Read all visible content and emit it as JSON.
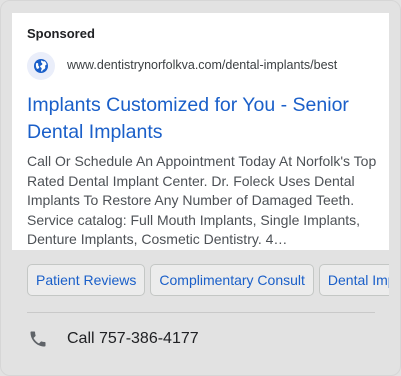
{
  "ad": {
    "label": "Sponsored",
    "favicon_icon": "globe-icon",
    "display_url": "www.dentistrynorfolkva.com/dental-implants/best",
    "headline": "Implants Customized for You - Senior Dental Implants",
    "description": "Call Or Schedule An Appointment Today At Norfolk's Top Rated Dental Implant Center. Dr. Foleck Uses Dental Implants To Restore Any Number of Damaged Teeth. Service catalog: Full Mouth Implants, Single Implants, Denture Implants, Cosmetic Dentistry. 4…"
  },
  "sitelinks": [
    {
      "label": "Patient Reviews"
    },
    {
      "label": "Complimentary Consult"
    },
    {
      "label": "Dental Implants"
    }
  ],
  "call": {
    "icon": "phone-icon",
    "label": "Call 757-386-4177"
  },
  "colors": {
    "link": "#1a5fc9",
    "favicon_bg": "#eaeefa",
    "globe": "#1a5fc9",
    "card_bg": "#e2e2e2"
  }
}
